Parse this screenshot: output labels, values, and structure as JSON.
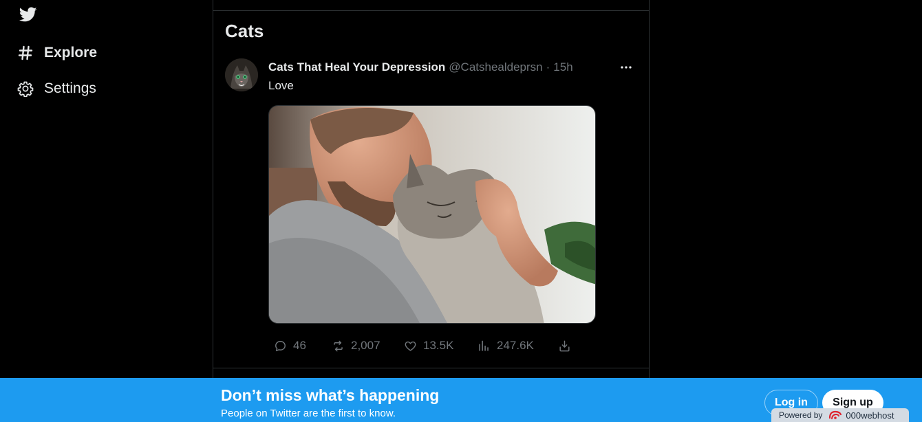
{
  "nav": {
    "items": [
      {
        "label": "Explore",
        "icon": "hashtag-icon"
      },
      {
        "label": "Settings",
        "icon": "gear-icon"
      }
    ]
  },
  "column": {
    "title": "Cats"
  },
  "tweet": {
    "author_name": "Cats That Heal Your Depression",
    "author_handle": "@Catshealdeprsn",
    "separator": "·",
    "time": "15h",
    "text": "Love",
    "media_description": "man hugging a cat",
    "stats": {
      "replies": "46",
      "retweets": "2,007",
      "likes": "13.5K",
      "views": "247.6K"
    }
  },
  "banner": {
    "title": "Don’t miss what’s happening",
    "subtitle": "People on Twitter are the first to know.",
    "login_label": "Log in",
    "signup_label": "Sign up"
  },
  "host_badge": {
    "prefix": "Powered by",
    "name": "000webhost"
  },
  "colors": {
    "background": "#000000",
    "accent": "#1d9bf0",
    "text": "#e7e9ea",
    "muted": "#71767b",
    "border": "#2f3336"
  }
}
